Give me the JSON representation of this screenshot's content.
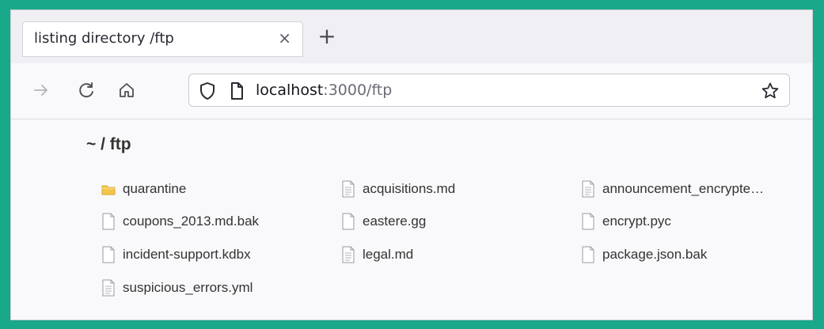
{
  "tab": {
    "title": "listing directory /ftp",
    "close_glyph": "×",
    "newtab_glyph": "+"
  },
  "toolbar": {
    "back_icon": "arrow-right-icon",
    "reload_icon": "reload-icon",
    "home_icon": "home-icon",
    "url_host": "localhost",
    "url_path": ":3000/ftp",
    "bookmark_icon": "star-icon"
  },
  "listing": {
    "heading": "~ / ftp",
    "columns": [
      [
        {
          "name": "quarantine",
          "type": "folder"
        },
        {
          "name": "coupons_2013.md.bak",
          "type": "blank"
        },
        {
          "name": "incident-support.kdbx",
          "type": "blank"
        },
        {
          "name": "suspicious_errors.yml",
          "type": "text"
        }
      ],
      [
        {
          "name": "acquisitions.md",
          "type": "text"
        },
        {
          "name": "eastere.gg",
          "type": "blank"
        },
        {
          "name": "legal.md",
          "type": "text"
        }
      ],
      [
        {
          "name": "announcement_encrypte…",
          "type": "text"
        },
        {
          "name": "encrypt.pyc",
          "type": "blank"
        },
        {
          "name": "package.json.bak",
          "type": "blank"
        }
      ]
    ]
  },
  "colors": {
    "frame": "#1aa88a",
    "folder": "#f3c64e"
  }
}
